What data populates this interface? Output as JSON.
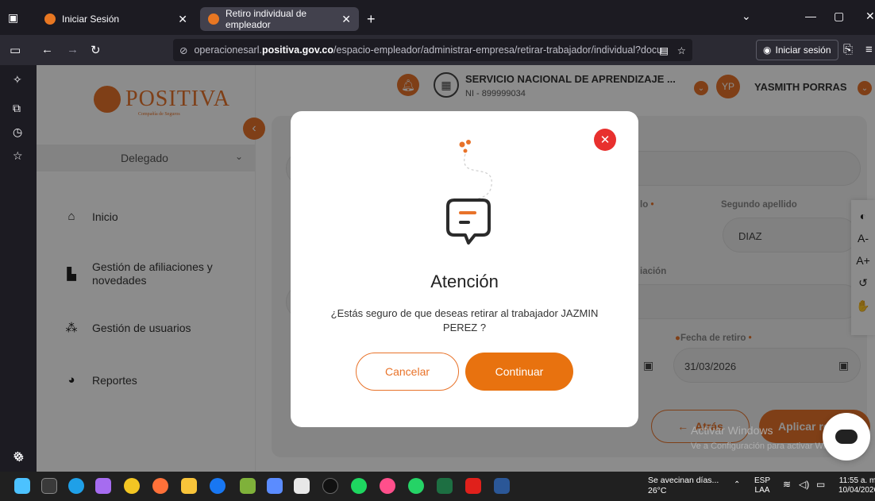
{
  "browser": {
    "tabs": [
      {
        "label": "Iniciar Sesión"
      },
      {
        "label": "Retiro individual de empleador"
      }
    ],
    "url_prefix": "operacionesarl.",
    "url_domain": "positiva.gov.co",
    "url_path": "/espacio-empleador/administrar-empresa/retirar-trabajador/individual?docu",
    "signin_label": "Iniciar sesión"
  },
  "sidebar": {
    "logo_text": "POSITIVA",
    "logo_sub": "Compañía de Seguros",
    "role": "Delegado",
    "items": [
      {
        "label": "Inicio"
      },
      {
        "label": "Gestión de afiliaciones y novedades"
      },
      {
        "label": "Gestión de usuarios"
      },
      {
        "label": "Reportes"
      }
    ]
  },
  "header": {
    "company": "SERVICIO NACIONAL DE APRENDIZAJE ...",
    "nit": "NI - 899999034",
    "initials": "YP",
    "user": "YASMITH PORRAS"
  },
  "form": {
    "segundo_apellido_label": "Segundo apellido",
    "segundo_apellido_value": "DIAZ",
    "fecha_retiro_label": "Fecha de retiro",
    "fecha_retiro_value": "31/03/2026",
    "partial_label_a": "lo",
    "partial_label_b": "iación",
    "atras_label": "Atrás",
    "aplicar_label": "Aplicar retir"
  },
  "watermark": {
    "line1": "Activar Windows",
    "line2": "Ve a Configuración para activar Windows."
  },
  "modal": {
    "title": "Atención",
    "message": "¿Estás seguro de que deseas retirar al trabajador JAZMIN PEREZ ?",
    "cancel_label": "Cancelar",
    "continue_label": "Continuar"
  },
  "taskbar": {
    "weather_text": "Se avecinan días...",
    "temperature": "26°C",
    "lang": "ESP",
    "lang_sub": "LAA",
    "time": "11:55 a. m.",
    "date": "10/04/2026"
  },
  "colors": {
    "brand": "#e8732a",
    "close": "#e8302e"
  }
}
